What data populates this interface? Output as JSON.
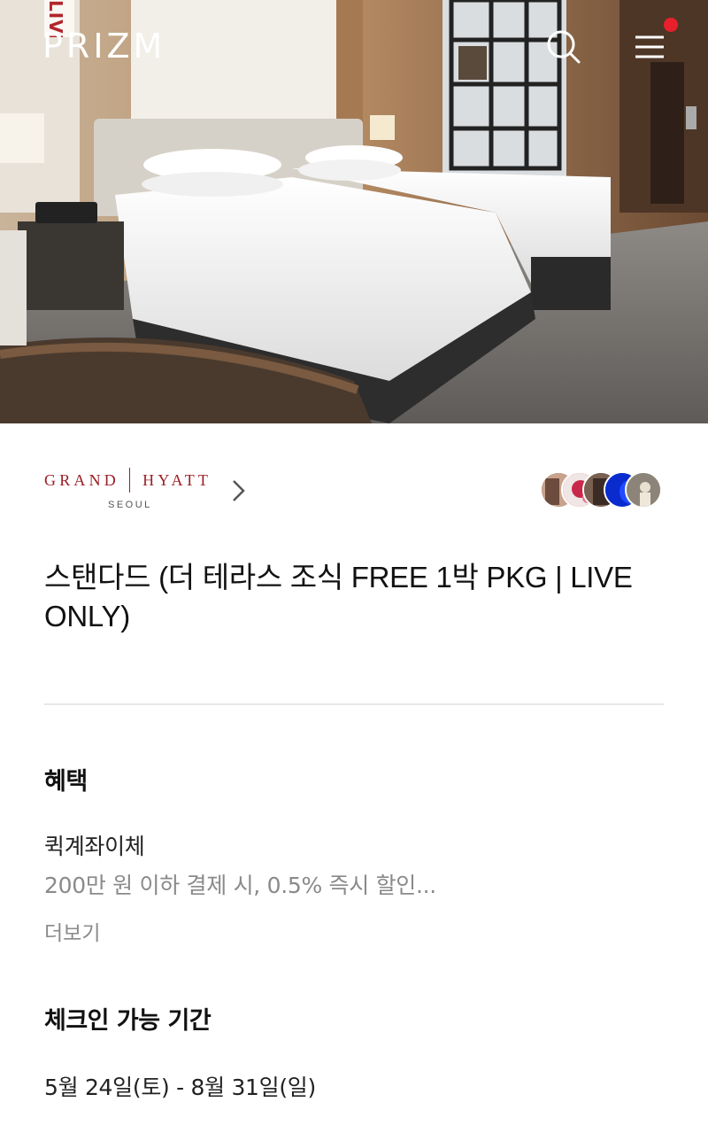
{
  "header": {
    "logo": "PRIZM",
    "logo_tag": "LIVE",
    "search_icon": "search-icon",
    "menu_icon": "hamburger-menu-icon",
    "notification_color": "#e8202b"
  },
  "hotel": {
    "brand_name": "GRAND",
    "brand_name_2": "HYATT",
    "city": "SEOUL",
    "brand_color": "#9a1f25",
    "chevron_icon": "chevron-right-icon"
  },
  "product": {
    "title": "스탠다드 (더 테라스 조식 FREE 1박 PKG | LIVE ONLY)"
  },
  "benefits": {
    "heading": "혜택",
    "name": "퀵계좌이체",
    "description": "200만 원 이하 결제 시, 0.5% 즉시 할인...",
    "more_label": "더보기"
  },
  "checkin": {
    "heading": "체크인 가능 기간",
    "period": "5월 24일(토) - 8월 31일(일)"
  }
}
